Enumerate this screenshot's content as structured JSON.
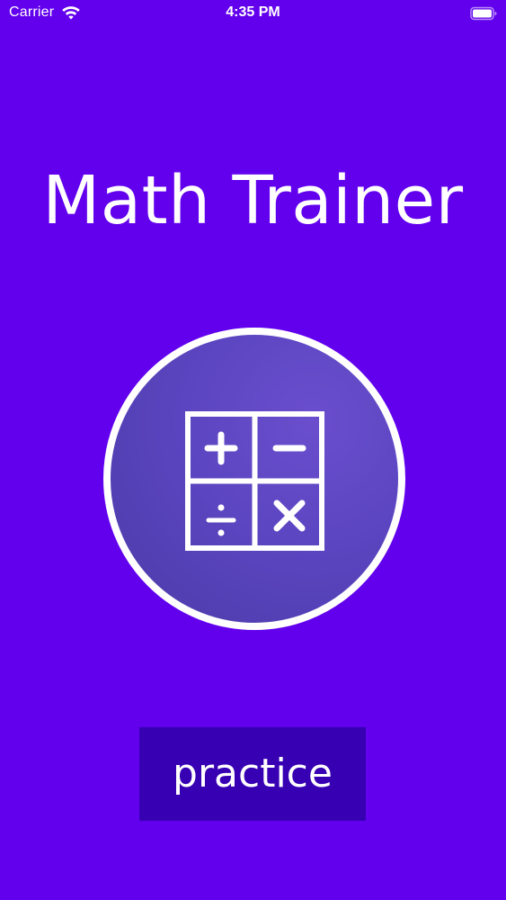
{
  "status_bar": {
    "carrier": "Carrier",
    "time": "4:35 PM",
    "wifi_icon": "wifi-icon",
    "battery_icon": "battery-icon"
  },
  "app": {
    "title": "Math Trainer",
    "logo_icon": "calculator-operations-icon",
    "practice_label": "practice"
  },
  "colors": {
    "background": "#6200EE",
    "button": "#3700B3",
    "circle": "#5B45C0",
    "foreground": "#FFFFFF"
  }
}
